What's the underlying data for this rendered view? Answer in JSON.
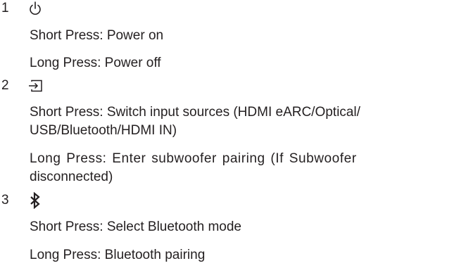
{
  "items": [
    {
      "number": "1",
      "icon": "power-icon",
      "lines": [
        "Short Press: Power on",
        "Long Press: Power off"
      ]
    },
    {
      "number": "2",
      "icon": "input-source-icon",
      "lines": [
        "Short Press: Switch input sources (HDMI eARC/Optical/",
        "USB/Bluetooth/HDMI IN)",
        "Long Press: Enter subwoofer pairing (If Subwoofer",
        "disconnected)"
      ]
    },
    {
      "number": "3",
      "icon": "bluetooth-icon",
      "lines": [
        "Short Press: Select Bluetooth mode",
        "Long Press: Bluetooth pairing"
      ]
    }
  ]
}
